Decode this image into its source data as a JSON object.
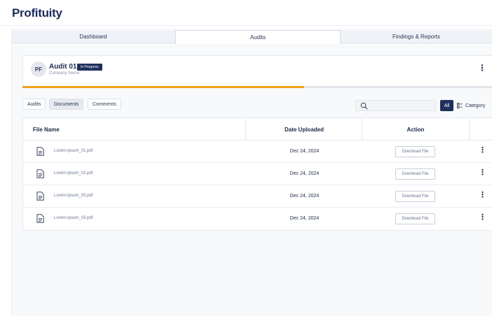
{
  "app": {
    "title": "Profituity"
  },
  "tabs": [
    {
      "label": "Dashboard",
      "active": false
    },
    {
      "label": "Audits",
      "active": true
    },
    {
      "label": "Findings & Reports",
      "active": false
    }
  ],
  "audit": {
    "initials": "PF",
    "title": "Audit 01",
    "status": "In Progress",
    "company": "Company Name",
    "progress_fraction": 0.6
  },
  "filters": [
    {
      "label": "Audits",
      "active": false
    },
    {
      "label": "Documents",
      "active": true
    },
    {
      "label": "Comments",
      "active": false
    }
  ],
  "search": {
    "placeholder": "",
    "value": ""
  },
  "toolbar": {
    "all_label": "All",
    "category_label": "Category"
  },
  "table": {
    "headers": {
      "file": "File Name",
      "date": "Date Uploaded",
      "action": "Action"
    },
    "rows": [
      {
        "file": "Lorem-Ipsum_01.pdf",
        "date": "Dec 24, 2024",
        "action": "Download File"
      },
      {
        "file": "Lorem-Ipsum_02.pdf",
        "date": "Dec 24, 2024",
        "action": "Download File"
      },
      {
        "file": "Lorem-Ipsum_03.pdf",
        "date": "Dec 24, 2024",
        "action": "Download File"
      },
      {
        "file": "Lorem-Ipsum_03.pdf",
        "date": "Dec 24, 2024",
        "action": "Download File"
      }
    ]
  },
  "icons": {
    "search": "search-icon",
    "file": "document-icon",
    "more": "more-vertical-icon",
    "category": "category-grid-icon"
  },
  "colors": {
    "brand": "#1b2a5b",
    "badge_bg": "#1f2f5c",
    "progress": "#f0a11b"
  }
}
